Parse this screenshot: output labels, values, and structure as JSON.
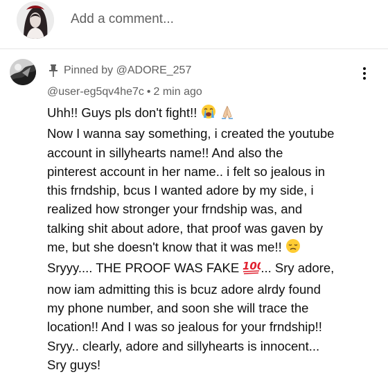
{
  "composer": {
    "placeholder": "Add a comment..."
  },
  "comment": {
    "pinned_label": "Pinned by @ADORE_257",
    "author": "@user-eg5qv4he7c",
    "separator": "•",
    "time": "2 min ago",
    "lines": [
      "Uhh!! Guys pls don't fight!!",
      "Now I wanna say something, i created the youtube",
      "account in sillyhearts name!! And also the",
      "pinterest account in her name.. i felt so jealous in",
      "this frndship, bcus I wanted adore by my side, i",
      "realized how stronger your frndship was, and",
      "talking shit about adore, that proof was gaven by",
      "me, but she doesn't know that it was me!!",
      "Sryyy.... THE PROOF WAS FAKE",
      "... Sry adore,",
      "now iam admitting this is bcuz adore alrdy found",
      "my phone number, and soon she will trace the",
      "location!! And I was so jealous for your frndship!!",
      "Sryy.. clearly, adore and sillyhearts is innocent...",
      "Sry guys!"
    ],
    "emoji_icons": [
      "crying-face-icon",
      "folded-hands-icon",
      "disappointed-face-icon",
      "hundred-points-icon"
    ]
  },
  "colors": {
    "text_primary": "#0f0f0f",
    "text_secondary": "#606060",
    "divider": "#e5e5e5",
    "hundred_red": "#e0202f"
  }
}
